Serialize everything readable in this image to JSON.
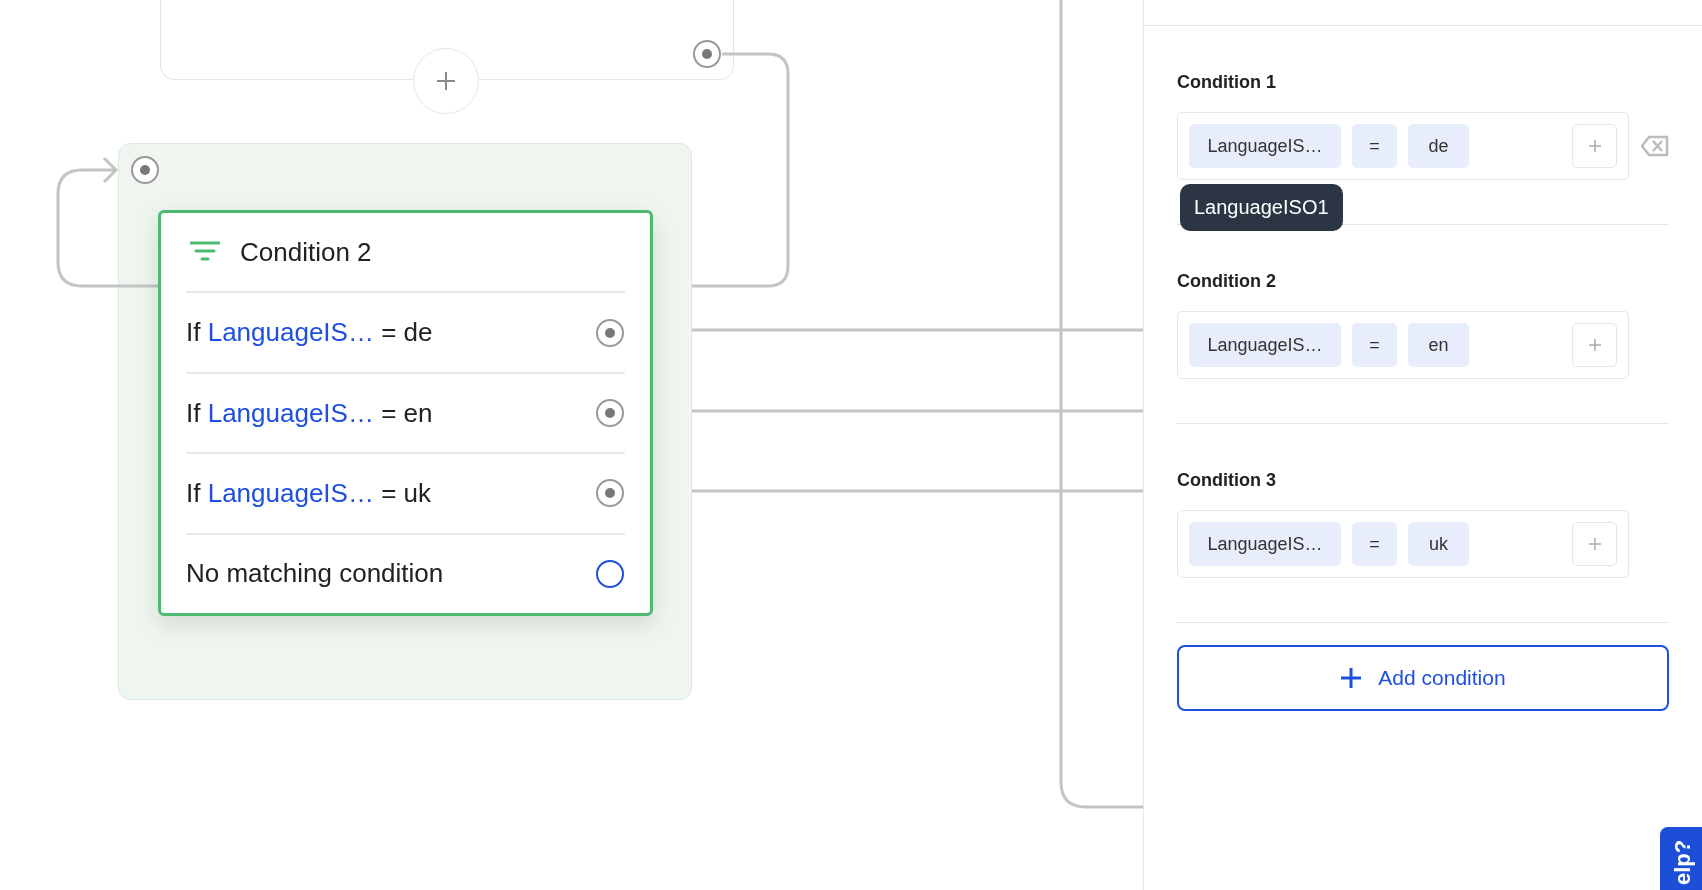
{
  "canvas": {
    "condition_node": {
      "title": "Condition 2",
      "rows": [
        {
          "kind": "rule",
          "prefix": "If",
          "variable": "LanguageIS…",
          "comparison": "= de",
          "connected": true
        },
        {
          "kind": "rule",
          "prefix": "If",
          "variable": "LanguageIS…",
          "comparison": "= en",
          "connected": true
        },
        {
          "kind": "rule",
          "prefix": "If",
          "variable": "LanguageIS…",
          "comparison": "= uk",
          "connected": true
        },
        {
          "kind": "fallback",
          "label": "No matching condition",
          "connected": false
        }
      ]
    }
  },
  "panel": {
    "conditions": [
      {
        "title": "Condition 1",
        "field": "LanguageIS…",
        "operator": "=",
        "value": "de",
        "hovered": true,
        "tooltip": "LanguageISO1"
      },
      {
        "title": "Condition 2",
        "field": "LanguageIS…",
        "operator": "=",
        "value": "en",
        "hovered": false
      },
      {
        "title": "Condition 3",
        "field": "LanguageIS…",
        "operator": "=",
        "value": "uk",
        "hovered": false
      }
    ],
    "add_button": "Add condition"
  },
  "help_tab": "elp?"
}
